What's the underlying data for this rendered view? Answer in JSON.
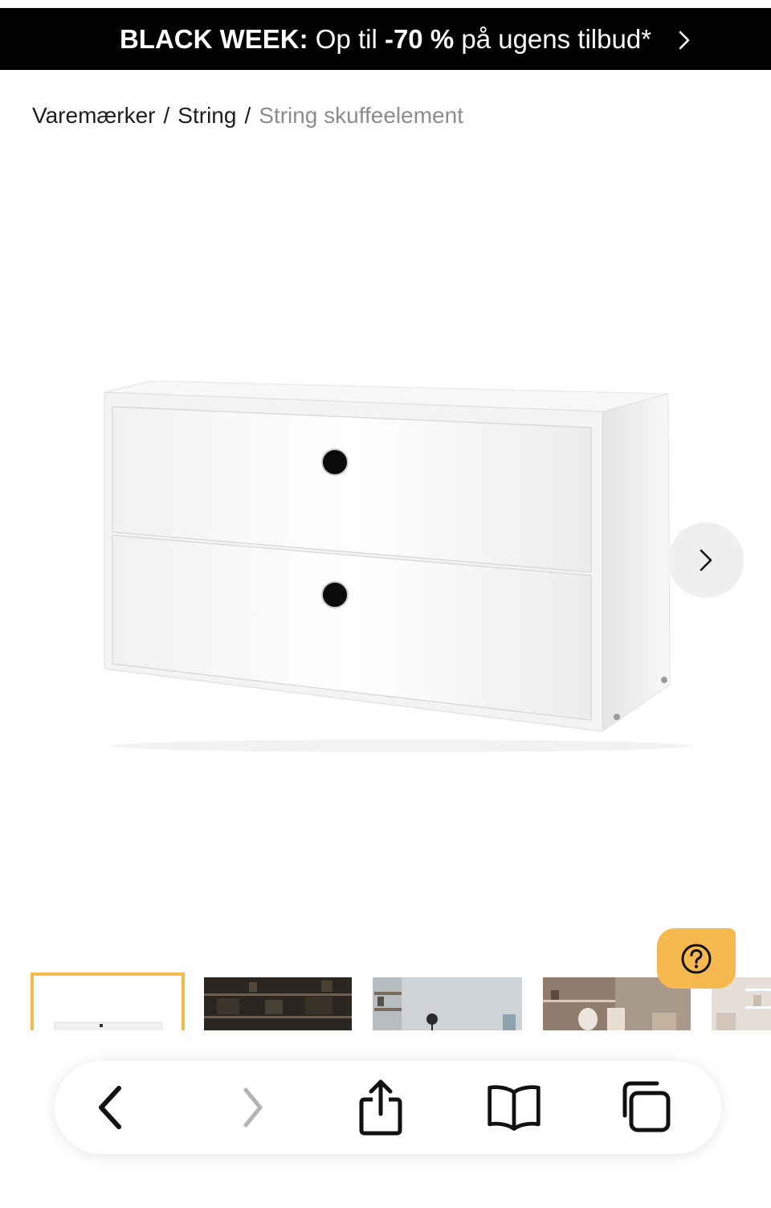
{
  "promo": {
    "bold_label": "BLACK WEEK:",
    "text_before": " Op til ",
    "discount": "-70 %",
    "text_after": " på ugens tilbud*"
  },
  "breadcrumb": {
    "item1": "Varemærker",
    "sep": "/",
    "item2": "String",
    "current": "String skuffeelement"
  },
  "product": {
    "image_icon": "white-drawer-cabinet"
  },
  "carousel": {
    "next_icon": "chevron-right-icon",
    "thumbnail_count": 5,
    "active_thumbnail": 1
  },
  "help": {
    "icon": "question-circle-icon",
    "color": "#f5b94f"
  },
  "browser_toolbar": {
    "icons": [
      "back-icon",
      "forward-icon",
      "share-icon",
      "bookmarks-icon",
      "tabs-icon"
    ]
  },
  "colors": {
    "promo_bg": "#000000",
    "accent": "#f5b94f",
    "breadcrumb_current": "#8c8c8c"
  }
}
